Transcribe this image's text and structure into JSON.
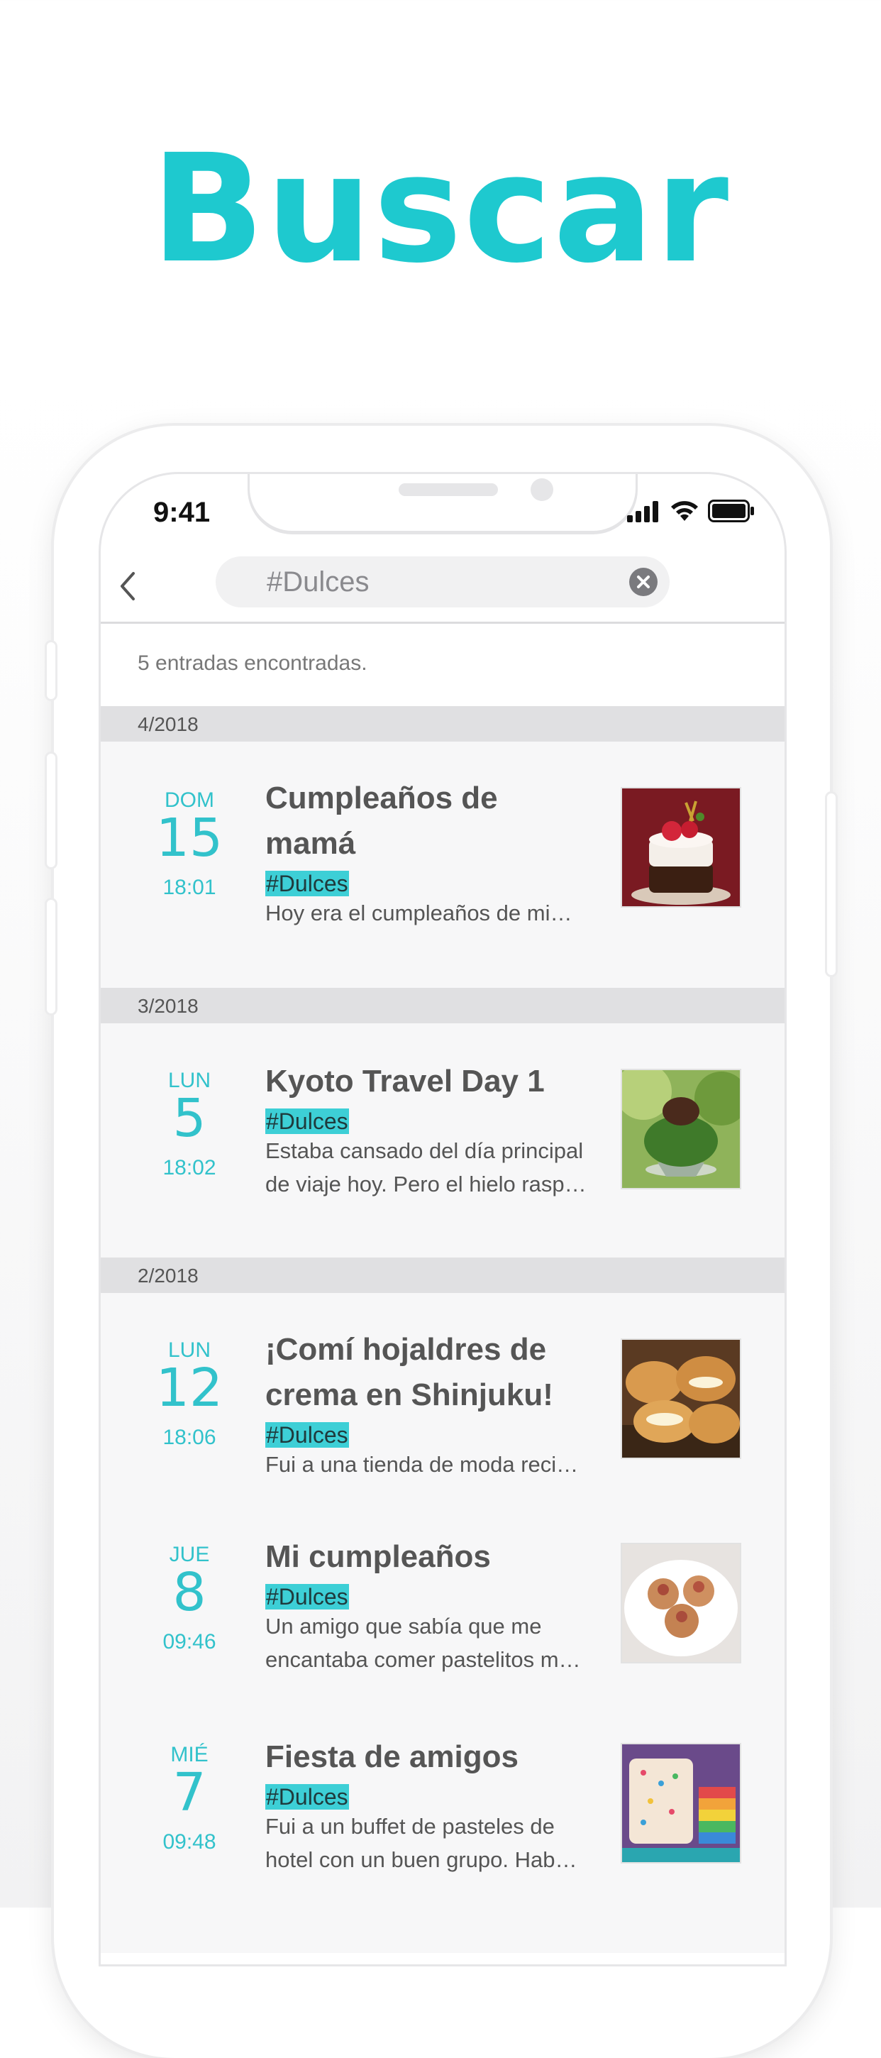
{
  "headline": "Buscar",
  "status_bar": {
    "time": "9:41"
  },
  "search": {
    "value": "#Dulces"
  },
  "results_count": "5 entradas encontradas.",
  "sections": [
    {
      "month": "4/2018",
      "entries": [
        {
          "dow": "DOM",
          "day": "15",
          "time": "18:01",
          "title_lines": [
            "Cumpleaños de",
            "mamá"
          ],
          "tag": "#Dulces",
          "excerpt_lines": [
            "Hoy era el cumpleaños de mi…"
          ],
          "thumb": "strawberry-cake"
        }
      ]
    },
    {
      "month": "3/2018",
      "entries": [
        {
          "dow": "LUN",
          "day": "5",
          "time": "18:02",
          "title_lines": [
            "Kyoto Travel Day 1"
          ],
          "tag": "#Dulces",
          "excerpt_lines": [
            "Estaba cansado del día principal",
            "de viaje hoy. Pero el hielo rasp…"
          ],
          "thumb": "matcha-shaved-ice"
        }
      ]
    },
    {
      "month": "2/2018",
      "entries": [
        {
          "dow": "LUN",
          "day": "12",
          "time": "18:06",
          "title_lines": [
            "¡Comí hojaldres de",
            "crema en Shinjuku!"
          ],
          "tag": "#Dulces",
          "excerpt_lines": [
            "Fui a una tienda de moda reci…"
          ],
          "thumb": "cream-puffs"
        },
        {
          "dow": "JUE",
          "day": "8",
          "time": "09:46",
          "title_lines": [
            "Mi cumpleaños"
          ],
          "tag": "#Dulces",
          "excerpt_lines": [
            "Un amigo que sabía que me",
            "encantaba comer pastelitos m…"
          ],
          "thumb": "pastries-plate"
        },
        {
          "dow": "MIÉ",
          "day": "7",
          "time": "09:48",
          "title_lines": [
            "Fiesta de amigos"
          ],
          "tag": "#Dulces",
          "excerpt_lines": [
            "Fui a un buffet de pasteles de",
            "hotel con un buen grupo. Hab…"
          ],
          "thumb": "rainbow-cake"
        }
      ]
    }
  ],
  "colors": {
    "accent": "#1ec9cf",
    "tag_bg": "#3dcfd6",
    "date": "#32c2cb"
  }
}
